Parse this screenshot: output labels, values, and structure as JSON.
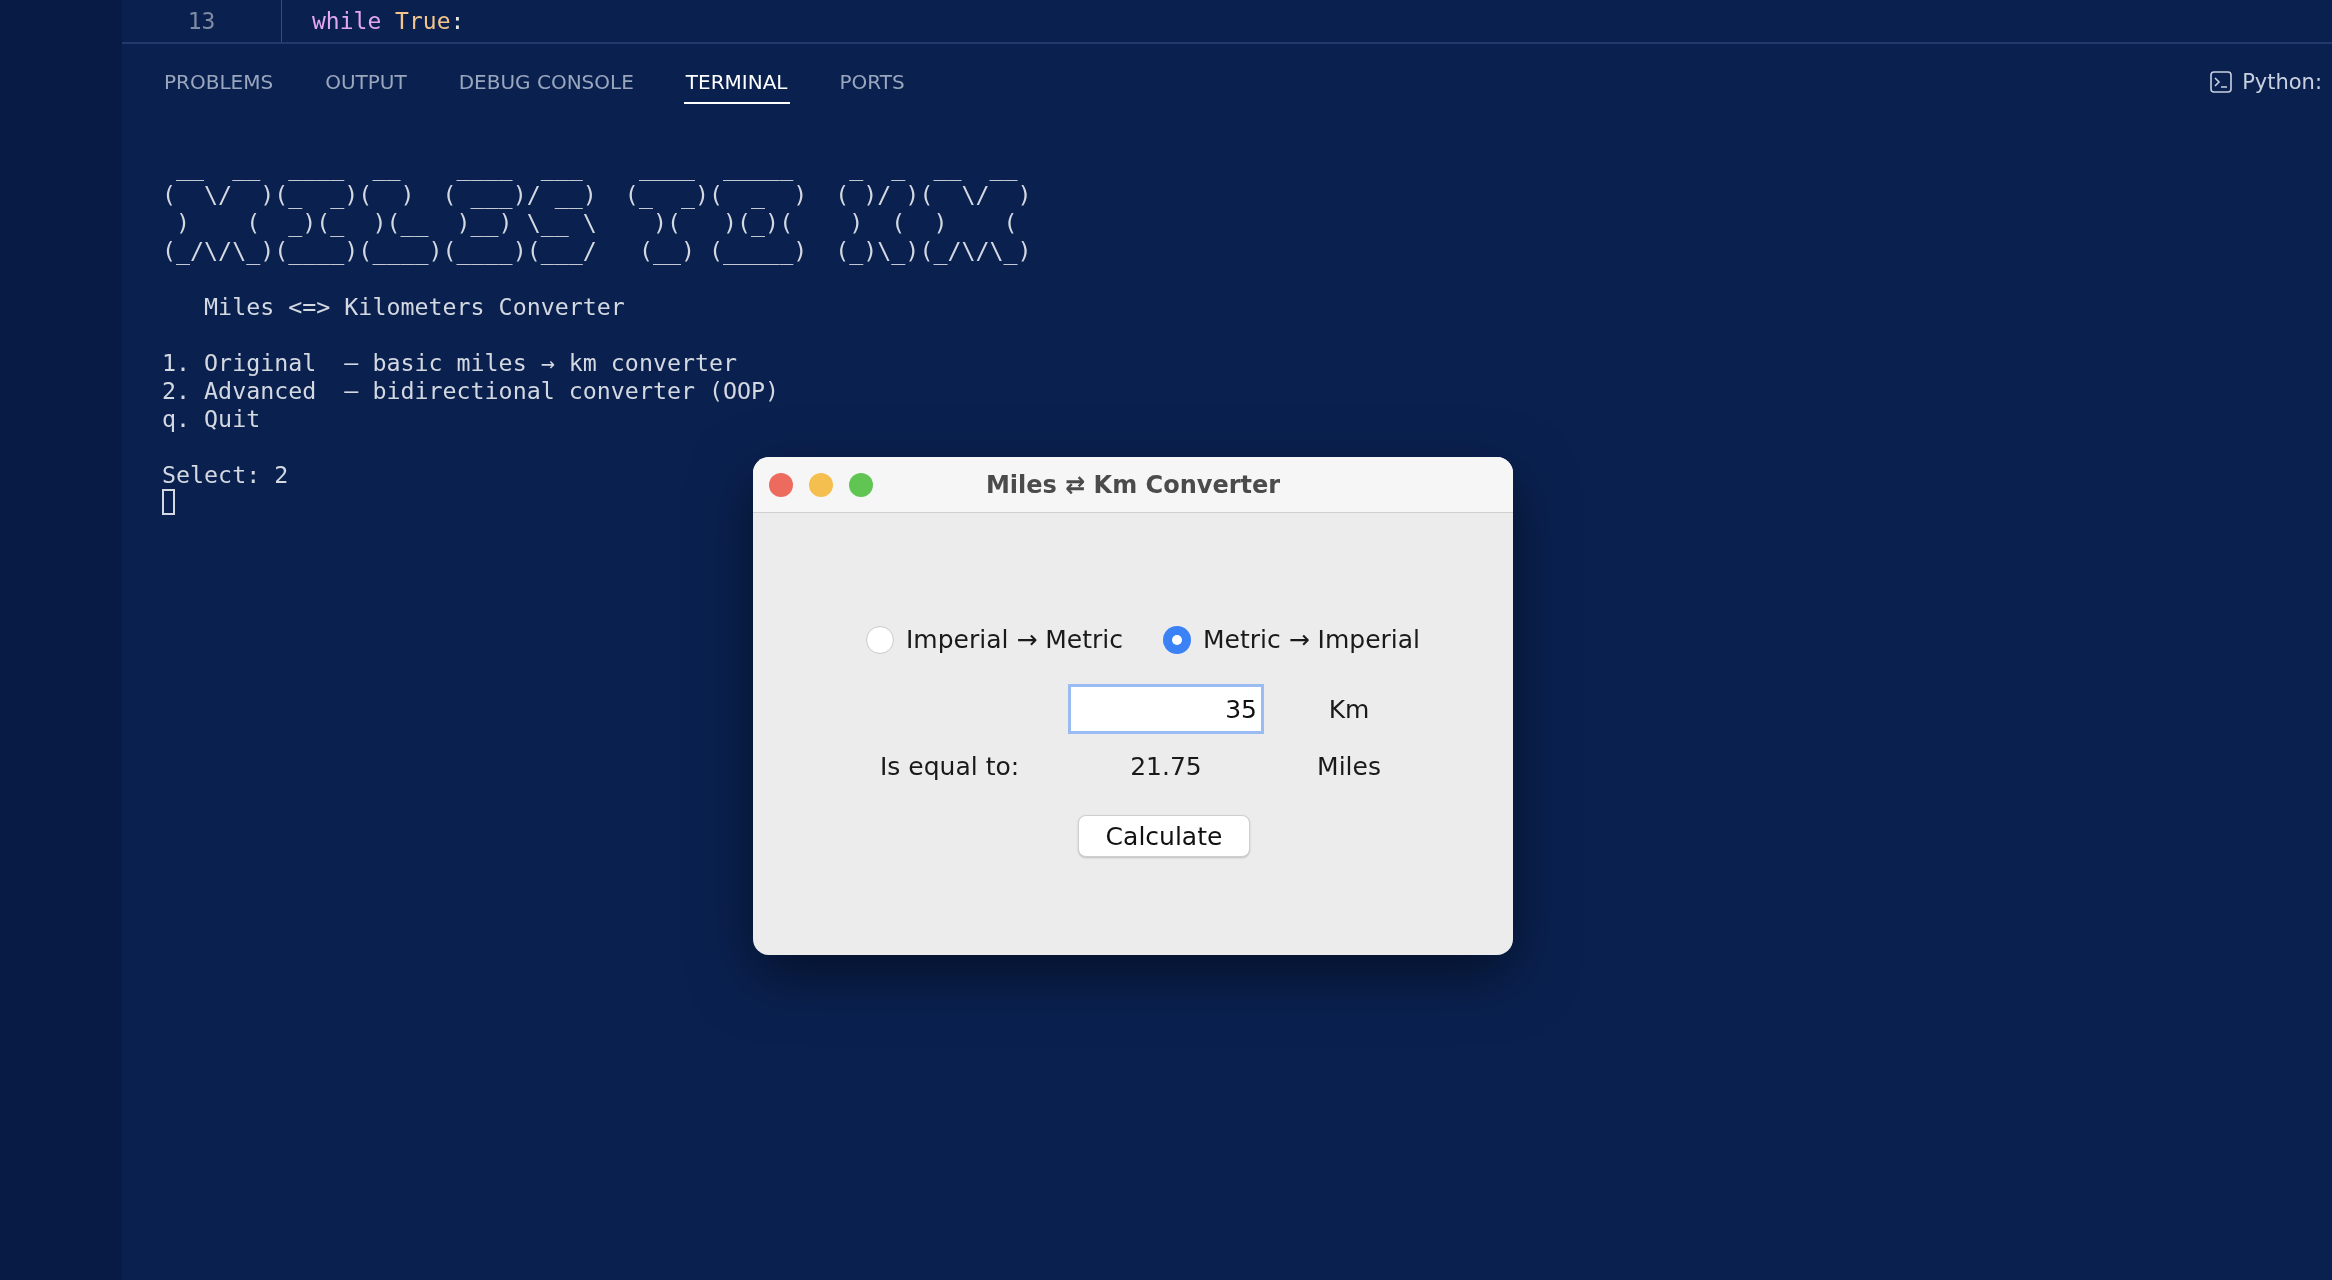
{
  "editor": {
    "line_number": "13",
    "code": [
      {
        "kind": "keyword",
        "text": "while"
      },
      {
        "kind": "constant",
        "text": "True"
      },
      {
        "kind": "punct",
        "text": ":"
      }
    ]
  },
  "panel_tabs": [
    {
      "label": "PROBLEMS",
      "selected": false
    },
    {
      "label": "OUTPUT",
      "selected": false
    },
    {
      "label": "DEBUG CONSOLE",
      "selected": false
    },
    {
      "label": "TERMINAL",
      "selected": true
    },
    {
      "label": "PORTS",
      "selected": false
    }
  ],
  "terminal_profile": "Python:",
  "terminal": {
    "banner": [
      " __  __  ____  __    ____  ___    ____  _____    _  _  __  __ ",
      "(  \\/  )(_  _)(  )  ( ___)/ __)  (_  _)(  _  )  ( )/ )(  \\/  )",
      " )    (  _)(_  )(__  )__) \\__ \\    )(   )(_)(    )  (  )    ( ",
      "(_/\\/\\_)(____)(____)(____)(___/   (__) (_____)  (_)\\_)(_/\\/\\_)"
    ],
    "subtitle": "   Miles <=> Kilometers Converter",
    "menu": [
      "1. Original  — basic miles → km converter",
      "2. Advanced  — bidirectional converter (OOP)",
      "q. Quit"
    ],
    "prompt": "Select: 2"
  },
  "dialog": {
    "title": "Miles ⇄ Km Converter",
    "radios": [
      {
        "label": "Imperial → Metric",
        "selected": false
      },
      {
        "label": "Metric → Imperial",
        "selected": true
      }
    ],
    "input": {
      "value": "35",
      "unit": "Km"
    },
    "result": {
      "label": "Is equal to:",
      "value": "21.75",
      "unit": "Miles"
    },
    "button": "Calculate"
  }
}
